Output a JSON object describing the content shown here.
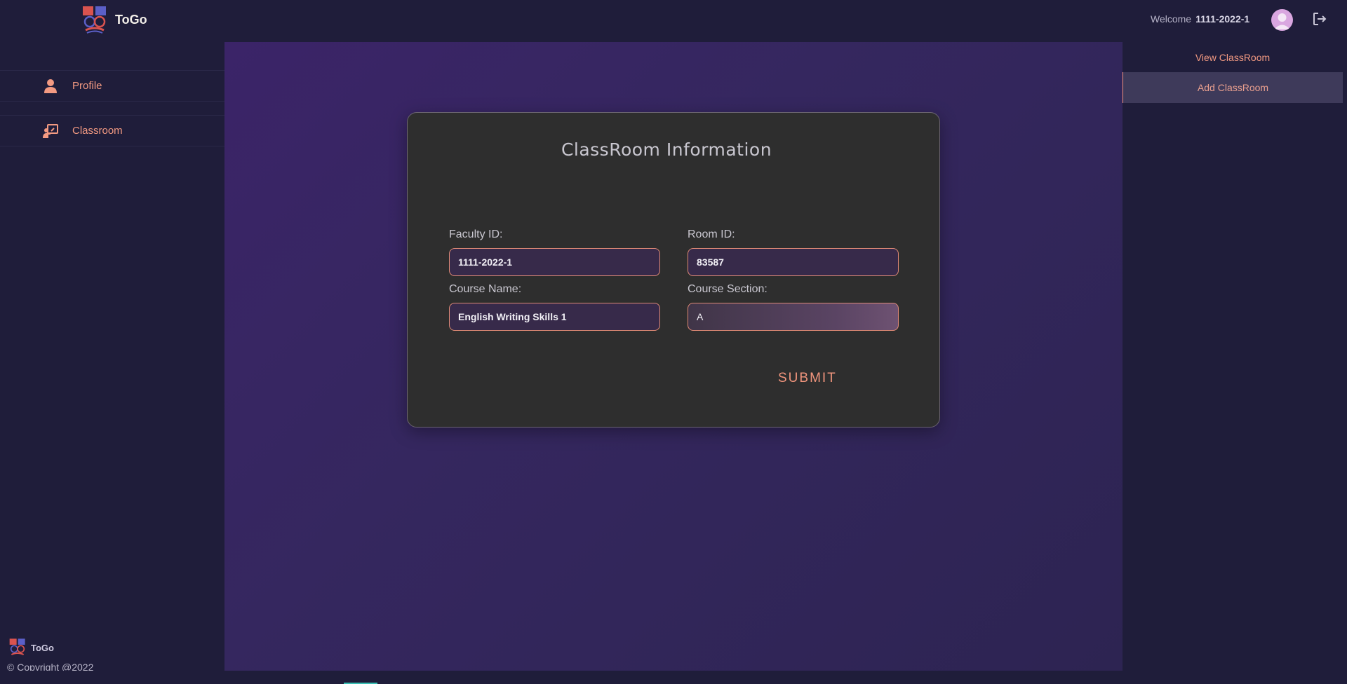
{
  "header": {
    "brand_name": "ToGo",
    "welcome_label": "Welcome",
    "user_id": "1111-2022-1"
  },
  "sidebar": {
    "items": [
      {
        "label": "Profile",
        "icon": "person-icon"
      },
      {
        "label": "Classroom",
        "icon": "classroom-icon"
      }
    ],
    "footer_brand": "ToGo",
    "copyright": "© Copyright @2022"
  },
  "form": {
    "title": "ClassRoom Information",
    "faculty_id_label": "Faculty ID:",
    "faculty_id_value": "1111-2022-1",
    "room_id_label": "Room ID:",
    "room_id_value": "83587",
    "course_name_label": "Course Name:",
    "course_name_value": "English Writing Skills 1",
    "course_section_label": "Course Section:",
    "course_section_value": "A",
    "submit_label": "SUBMIT"
  },
  "right_panel": {
    "view_label": "View ClassRoom",
    "add_label": "Add ClassRoom"
  },
  "colors": {
    "accent": "#f39a82",
    "background": "#1f1d3a",
    "card": "#2e2e2e"
  }
}
